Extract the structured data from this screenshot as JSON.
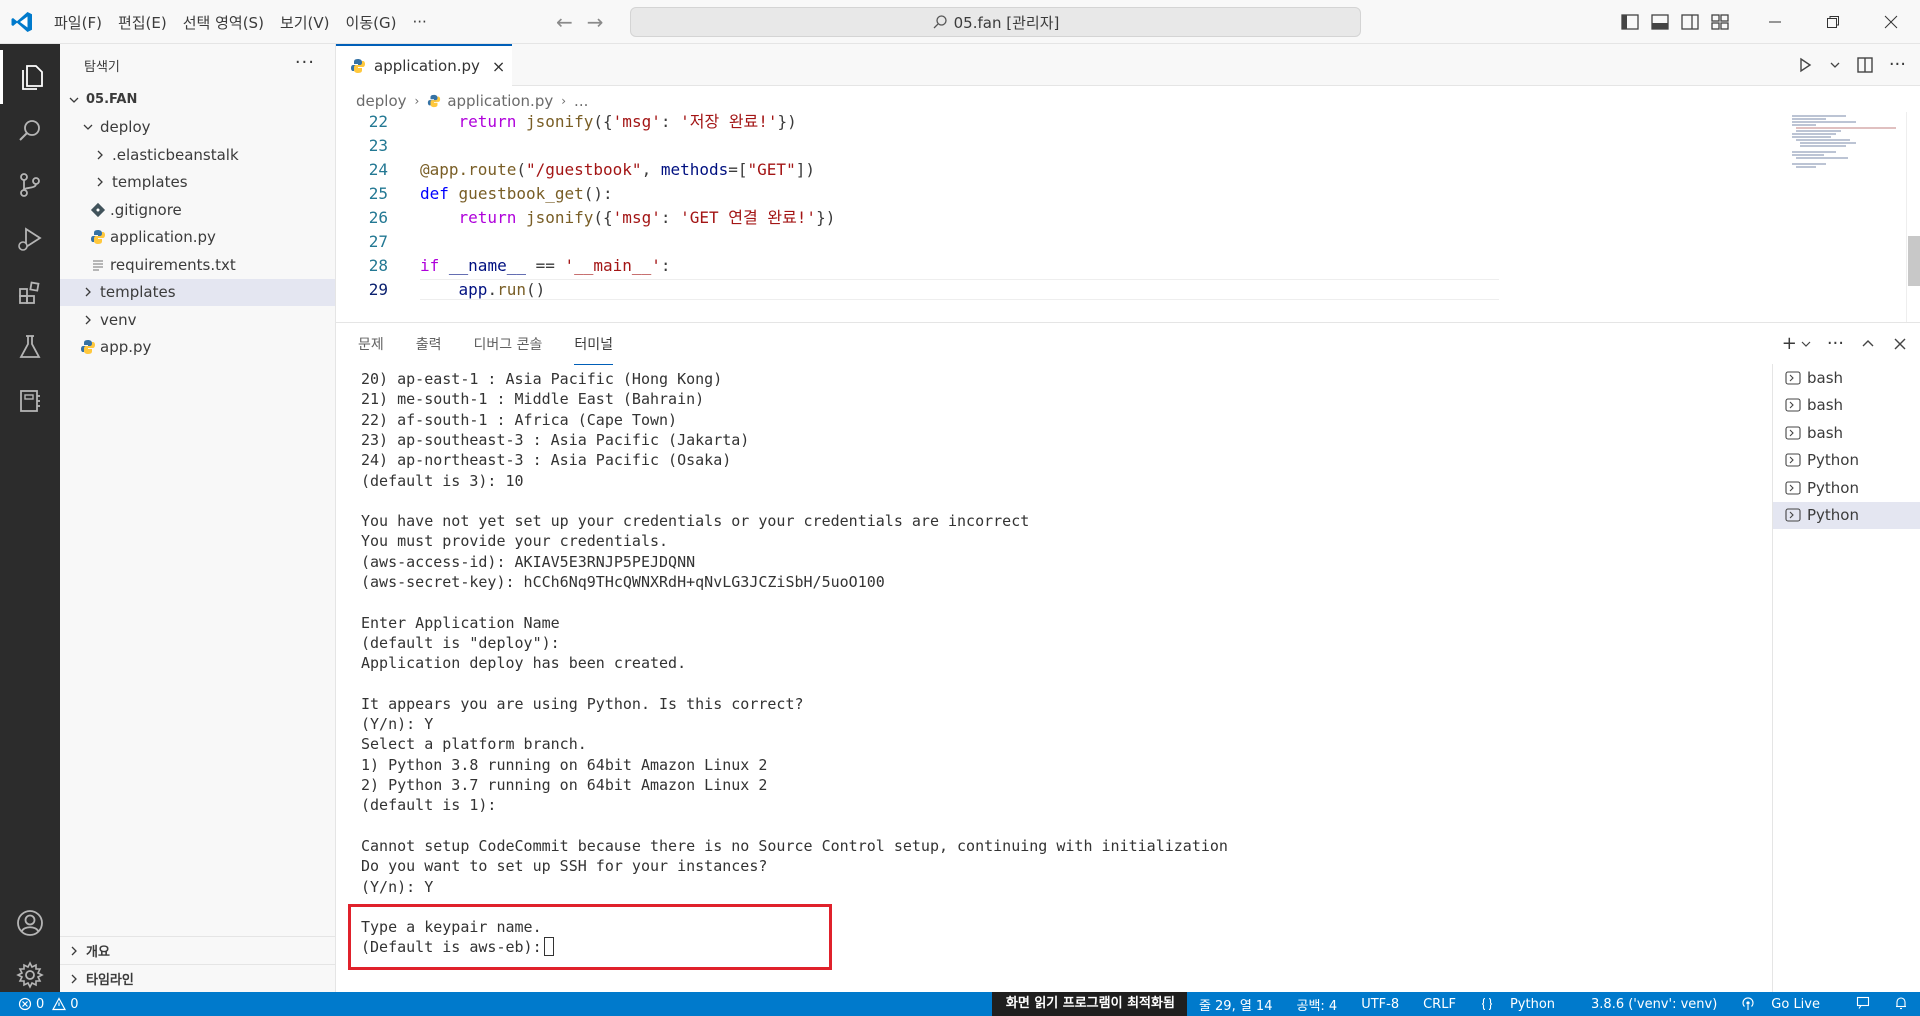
{
  "titlebar": {
    "menu": [
      "파일(F)",
      "편집(E)",
      "선택 영역(S)",
      "보기(V)",
      "이동(G)",
      "···"
    ],
    "search_text": "05.fan [관리자]"
  },
  "sidebar": {
    "title": "탐색기",
    "more": "···",
    "root": "05.FAN",
    "items": [
      {
        "label": "deploy"
      },
      {
        "label": ".elasticbeanstalk"
      },
      {
        "label": "templates"
      },
      {
        "label": ".gitignore"
      },
      {
        "label": "application.py"
      },
      {
        "label": "requirements.txt"
      },
      {
        "label": "templates"
      },
      {
        "label": "venv"
      },
      {
        "label": "app.py"
      }
    ],
    "bottom": [
      "개요",
      "타임라인"
    ]
  },
  "editor": {
    "tab_label": "application.py",
    "tab_close": "×",
    "breadcrumb": [
      "deploy",
      "application.py",
      "..."
    ],
    "lines": [
      {
        "n": "22",
        "text": "return jsonify({'msg': '저장 완료!'})"
      },
      {
        "n": "23",
        "text": ""
      },
      {
        "n": "24",
        "text": "@app.route(\"/guestbook\", methods=[\"GET\"])"
      },
      {
        "n": "25",
        "text": "def guestbook_get():"
      },
      {
        "n": "26",
        "text": "return jsonify({'msg': 'GET 연결 완료!'})"
      },
      {
        "n": "27",
        "text": ""
      },
      {
        "n": "28",
        "text": "if __name__ == '__main__':"
      },
      {
        "n": "29",
        "text": "app.run()"
      }
    ]
  },
  "panel": {
    "tabs": [
      "문제",
      "출력",
      "디버그 콘솔",
      "터미널"
    ],
    "active_tab": "터미널",
    "terminal_lines": [
      "20) ap-east-1 : Asia Pacific (Hong Kong)",
      "21) me-south-1 : Middle East (Bahrain)",
      "22) af-south-1 : Africa (Cape Town)",
      "23) ap-southeast-3 : Asia Pacific (Jakarta)",
      "24) ap-northeast-3 : Asia Pacific (Osaka)",
      "(default is 3): 10",
      "",
      "You have not yet set up your credentials or your credentials are incorrect",
      "You must provide your credentials.",
      "(aws-access-id): AKIAV5E3RNJP5PEJDQNN",
      "(aws-secret-key): hCCh6Nq9THcQWNXRdH+qNvLG3JCZiSbH/5uoO100",
      "",
      "Enter Application Name",
      "(default is \"deploy\"):",
      "Application deploy has been created.",
      "",
      "It appears you are using Python. Is this correct?",
      "(Y/n): Y",
      "Select a platform branch.",
      "1) Python 3.8 running on 64bit Amazon Linux 2",
      "2) Python 3.7 running on 64bit Amazon Linux 2",
      "(default is 1):",
      "",
      "Cannot setup CodeCommit because there is no Source Control setup, continuing with initialization",
      "Do you want to set up SSH for your instances?",
      "(Y/n): Y",
      "",
      "Type a keypair name.",
      "(Default is aws-eb):"
    ],
    "terminals": [
      "bash",
      "bash",
      "bash",
      "Python",
      "Python",
      "Python"
    ]
  },
  "statusbar": {
    "errors": "0",
    "warnings": "0",
    "accessibility": "화면 읽기 프로그램이 최적화됨",
    "position": "줄 29, 열 14",
    "spaces": "공백: 4",
    "encoding": "UTF-8",
    "eol": "CRLF",
    "language": "Python",
    "interpreter": "3.8.6 ('venv': venv)",
    "golive": "Go Live"
  },
  "colors": {
    "accent": "#007acc",
    "highlight_box": "#e0212b"
  }
}
